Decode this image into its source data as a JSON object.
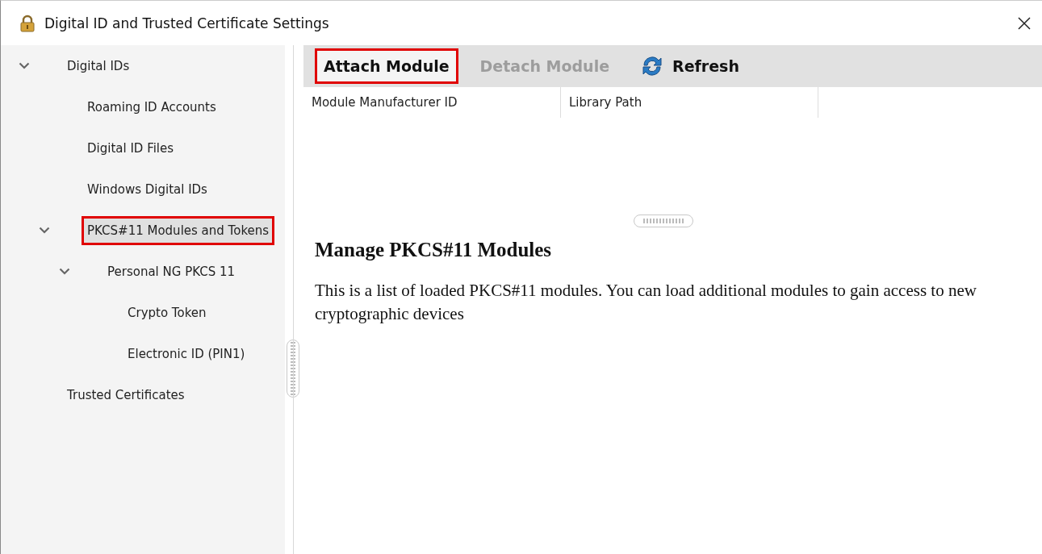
{
  "window": {
    "title": "Digital ID and Trusted Certificate Settings"
  },
  "sidebar": {
    "tree": [
      {
        "label": "Digital IDs",
        "expanded": true,
        "selected": false,
        "highlighted": false,
        "children": [
          {
            "label": "Roaming ID Accounts",
            "selected": false,
            "highlighted": false
          },
          {
            "label": "Digital ID Files",
            "selected": false,
            "highlighted": false
          },
          {
            "label": "Windows Digital IDs",
            "selected": false,
            "highlighted": false
          },
          {
            "label": "PKCS#11 Modules and Tokens",
            "expanded": true,
            "selected": true,
            "highlighted": true,
            "children": [
              {
                "label": "Personal NG PKCS 11",
                "expanded": true,
                "selected": false,
                "highlighted": false,
                "children": [
                  {
                    "label": "Crypto Token",
                    "selected": false,
                    "highlighted": false
                  },
                  {
                    "label": "Electronic ID (PIN1)",
                    "selected": false,
                    "highlighted": false
                  }
                ]
              }
            ]
          }
        ]
      },
      {
        "label": "Trusted Certificates",
        "selected": false,
        "highlighted": false
      }
    ]
  },
  "toolbar": [
    {
      "label": "Attach Module",
      "kind": "text",
      "disabled": false,
      "highlighted": true
    },
    {
      "label": "Detach Module",
      "kind": "text",
      "disabled": true,
      "highlighted": false
    },
    {
      "label": "Refresh",
      "kind": "refresh",
      "disabled": false,
      "highlighted": false
    }
  ],
  "table": {
    "columns": [
      "Module Manufacturer ID",
      "Library Path"
    ]
  },
  "info": {
    "heading": "Manage PKCS#11 Modules",
    "text": "This is a list of loaded PKCS#11 modules. You can load additional modules to gain access to new cryptographic devices"
  }
}
